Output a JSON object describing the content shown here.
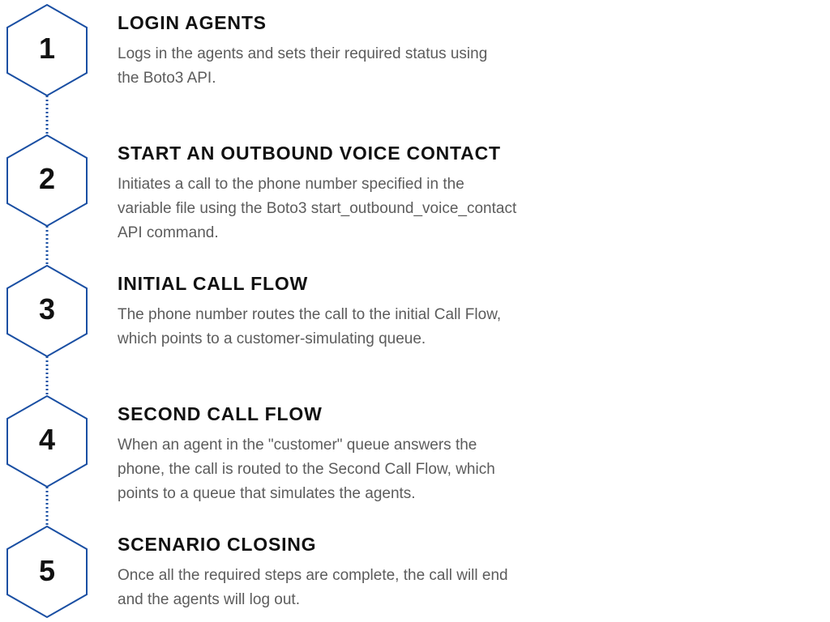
{
  "accent_color": "#1a4fa3",
  "steps": [
    {
      "number": "1",
      "title": "LOGIN AGENTS",
      "desc1": "Logs in the agents and sets their required status using",
      "desc2": "the Boto3 API.",
      "desc3": ""
    },
    {
      "number": "2",
      "title": "START AN OUTBOUND VOICE CONTACT",
      "desc1": "Initiates a call to the phone number specified in the",
      "desc2": "variable file using the Boto3 start_outbound_voice_contact",
      "desc3": "API command."
    },
    {
      "number": "3",
      "title": "INITIAL CALL FLOW",
      "desc1": "The phone number routes the call to the initial Call Flow,",
      "desc2": "which points to a customer-simulating queue.",
      "desc3": ""
    },
    {
      "number": "4",
      "title": "SECOND CALL FLOW",
      "desc1": "When an agent in the \"customer\" queue answers the",
      "desc2": "phone, the call is routed to the Second Call Flow, which",
      "desc3": "points to a queue that simulates the agents."
    },
    {
      "number": "5",
      "title": "SCENARIO CLOSING",
      "desc1": "Once all the required steps are complete, the call will end",
      "desc2": "and the agents will log out.",
      "desc3": ""
    }
  ]
}
